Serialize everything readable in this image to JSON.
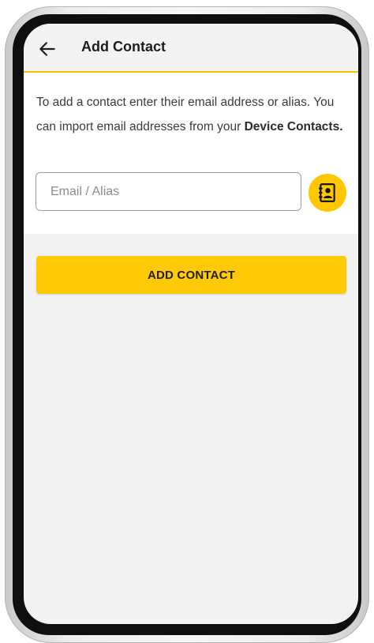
{
  "header": {
    "back_icon": "arrow-left-icon",
    "title": "Add Contact"
  },
  "instructions": {
    "text_before": "To add a contact enter their email address or alias. You can import email addresses from your ",
    "bold_text": "Device Contacts."
  },
  "email_field": {
    "placeholder": "Email / Alias",
    "value": ""
  },
  "device_contacts_button": {
    "icon": "contact-book-icon"
  },
  "add_button": {
    "label": "ADD CONTACT"
  },
  "colors": {
    "accent": "#ffca05",
    "accent_border": "#f7c500",
    "background": "#f2f2f2",
    "text": "#3b3b3b"
  }
}
